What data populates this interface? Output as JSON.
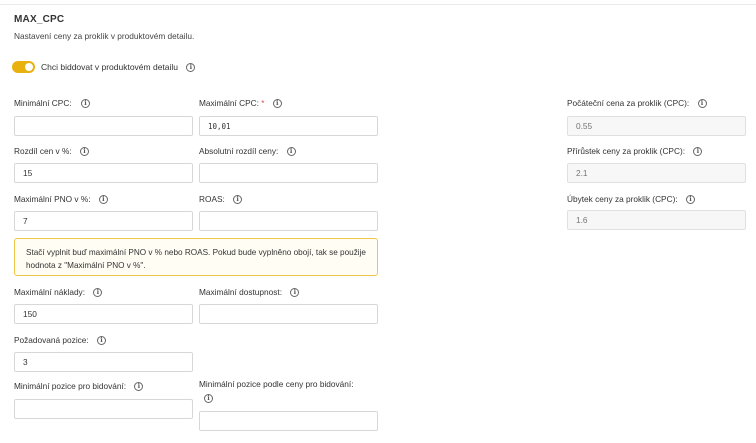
{
  "header": {
    "title": "MAX_CPC",
    "subtitle": "Nastavení ceny za proklik v produktovém detailu."
  },
  "toggle": {
    "label": "Chci biddovat v produktovém detailu",
    "enabled": true,
    "color": "#e9b10f"
  },
  "fields": {
    "min_cpc": {
      "label": "Minimální CPC:",
      "value": ""
    },
    "max_cpc": {
      "label": "Maximální CPC:",
      "required_mark": "*",
      "value": "10,01"
    },
    "price_diff_pct": {
      "label": "Rozdíl cen v %:",
      "value": "15"
    },
    "abs_price_diff": {
      "label": "Absolutní rozdíl ceny:",
      "value": ""
    },
    "max_pno_pct": {
      "label": "Maximální PNO v %:",
      "value": "7"
    },
    "roas": {
      "label": "ROAS:",
      "value": ""
    },
    "max_costs": {
      "label": "Maximální náklady:",
      "value": "150"
    },
    "max_availability": {
      "label": "Maximální dostupnost:",
      "value": ""
    },
    "desired_position": {
      "label": "Požadovaná pozice:",
      "value": "3"
    },
    "min_bid_position": {
      "label": "Minimální pozice pro bidování:",
      "value": ""
    },
    "min_price_bid_position": {
      "label": "Minimální pozice podle ceny pro bidování:",
      "value": ""
    },
    "start_price": {
      "label": "Počáteční cena za proklik (CPC):",
      "placeholder": "0.55"
    },
    "price_increment": {
      "label": "Přírůstek ceny za proklik (CPC):",
      "placeholder": "2.1"
    },
    "price_decrement": {
      "label": "Úbytek ceny za proklik (CPC):",
      "placeholder": "1.6"
    }
  },
  "alert": {
    "text": "Stačí vyplnit buď maximální PNO v % nebo ROAS. Pokud bude vyplněno obojí, tak se použije hodnota z \"Maximální PNO v %\"."
  },
  "icons": {
    "info": "info-circle-icon",
    "info_glyph": "i"
  }
}
